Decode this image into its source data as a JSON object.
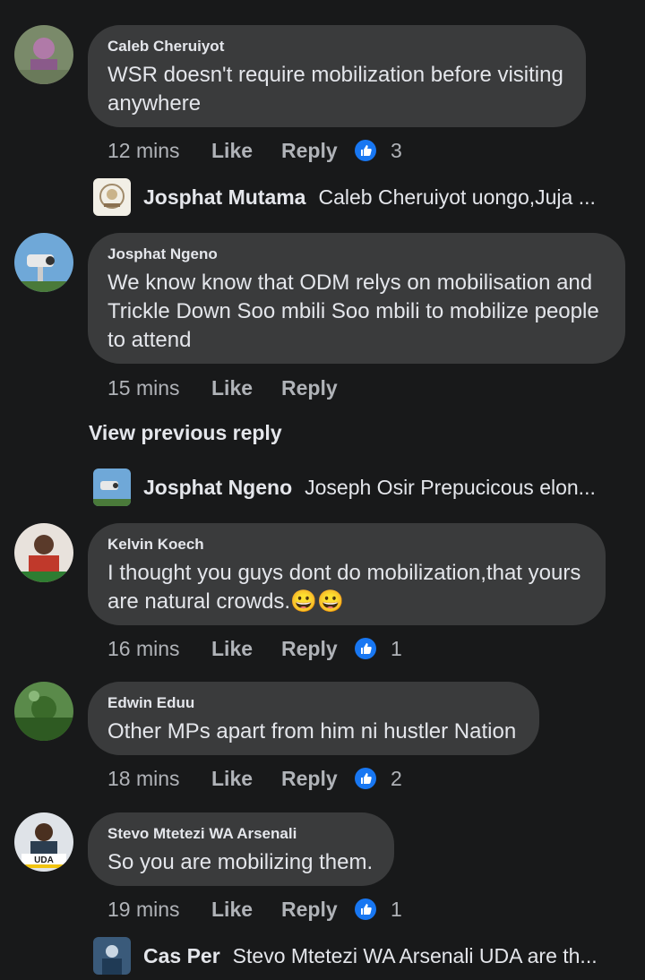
{
  "comments": [
    {
      "author": "Caleb Cheruiyot",
      "text": "WSR doesn't require mobilization before visiting anywhere",
      "time": "12 mins",
      "like": "Like",
      "reply": "Reply",
      "reactions": "3"
    },
    {
      "author": "Josphat Ngeno",
      "text": "We know know that ODM relys on mobilisation and Trickle Down Soo mbili Soo mbili to mobilize people to attend",
      "time": "15 mins",
      "like": "Like",
      "reply": "Reply"
    },
    {
      "author": "Kelvin Koech",
      "text": "I thought you guys dont do mobilization,that yours are natural crowds.",
      "emoji": "😀😀",
      "time": "16 mins",
      "like": "Like",
      "reply": "Reply",
      "reactions": "1"
    },
    {
      "author": "Edwin Eduu",
      "text": "Other MPs apart from him ni hustler Nation",
      "time": "18 mins",
      "like": "Like",
      "reply": "Reply",
      "reactions": "2"
    },
    {
      "author": "Stevo Mtetezi WA Arsenali",
      "text": "So you are mobilizing them.",
      "time": "19 mins",
      "like": "Like",
      "reply": "Reply",
      "reactions": "1",
      "avatar_badge": "UDA"
    }
  ],
  "replies": [
    {
      "name": "Josphat Mutama",
      "text": "Caleb Cheruiyot uongo,Juja ..."
    },
    {
      "name": "Josphat Ngeno",
      "text": "Joseph Osir Prepucicous elon..."
    },
    {
      "name": "Cas Per",
      "text": "Stevo Mtetezi WA Arsenali UDA are th..."
    }
  ],
  "view_previous": "View previous reply",
  "colors": {
    "background": "#18191a",
    "bubble": "#3a3b3c",
    "text": "#e4e6eb",
    "secondary": "#b0b3b8",
    "like_blue": "#1877f2"
  }
}
